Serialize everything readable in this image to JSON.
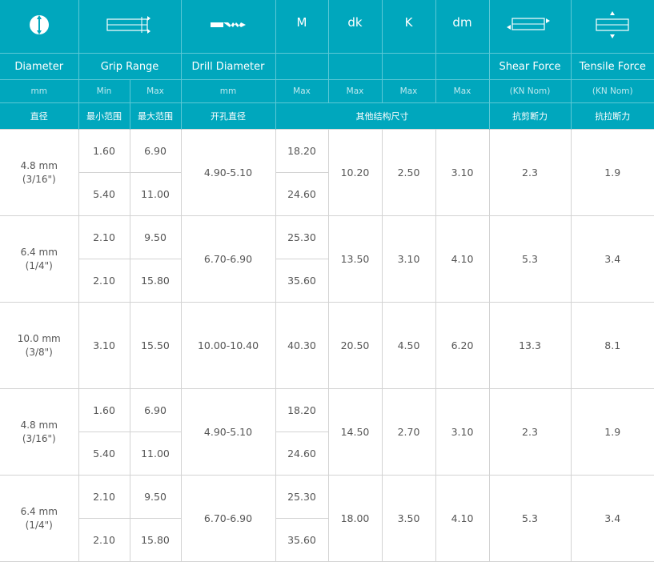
{
  "headers": {
    "diameter": {
      "title": "Diameter",
      "unit": "mm",
      "cn": "直径",
      "icon": "diameter-icon"
    },
    "grip": {
      "title": "Grip Range",
      "min": "Min",
      "max": "Max",
      "cn_min": "最小范围",
      "cn_max": "最大范围",
      "icon": "grip-range-icon"
    },
    "drill": {
      "title": "Drill Diameter",
      "unit": "mm",
      "cn": "开孔直径",
      "icon": "drill-bit-icon"
    },
    "m": {
      "symbol": "M",
      "unit": "Max"
    },
    "dk": {
      "symbol": "dk",
      "unit": "Max"
    },
    "k": {
      "symbol": "K",
      "unit": "Max"
    },
    "dm": {
      "symbol": "dm",
      "unit": "Max"
    },
    "other_cn": "其他结构尺寸",
    "shear": {
      "title": "Shear Force",
      "unit": "(KN Nom)",
      "cn": "抗剪断力",
      "icon": "shear-force-icon"
    },
    "tensile": {
      "title": "Tensile Force",
      "unit": "(KN Nom)",
      "cn": "抗拉断力",
      "icon": "tensile-force-icon"
    }
  },
  "colors": {
    "header_bg": "#00a7bd",
    "header_text": "#ffffff",
    "cell_text": "#555555",
    "border": "#d3d3d3"
  },
  "rows": [
    {
      "dia": "4.8 mm",
      "dia_in": "(3/16\")",
      "g1_min": "1.60",
      "g1_max": "6.90",
      "g2_min": "5.40",
      "g2_max": "11.00",
      "drill": "4.90-5.10",
      "m1": "18.20",
      "m2": "24.60",
      "dk": "10.20",
      "k": "2.50",
      "dm": "3.10",
      "shear": "2.3",
      "tensile": "1.9"
    },
    {
      "dia": "6.4 mm",
      "dia_in": "(1/4\")",
      "g1_min": "2.10",
      "g1_max": "9.50",
      "g2_min": "2.10",
      "g2_max": "15.80",
      "drill": "6.70-6.90",
      "m1": "25.30",
      "m2": "35.60",
      "dk": "13.50",
      "k": "3.10",
      "dm": "4.10",
      "shear": "5.3",
      "tensile": "3.4"
    },
    {
      "dia": "10.0 mm",
      "dia_in": "(3/8\")",
      "g_min": "3.10",
      "g_max": "15.50",
      "drill": "10.00-10.40",
      "m": "40.30",
      "dk": "20.50",
      "k": "4.50",
      "dm": "6.20",
      "shear": "13.3",
      "tensile": "8.1"
    },
    {
      "dia": "4.8 mm",
      "dia_in": "(3/16\")",
      "g1_min": "1.60",
      "g1_max": "6.90",
      "g2_min": "5.40",
      "g2_max": "11.00",
      "drill": "4.90-5.10",
      "m1": "18.20",
      "m2": "24.60",
      "dk": "14.50",
      "k": "2.70",
      "dm": "3.10",
      "shear": "2.3",
      "tensile": "1.9"
    },
    {
      "dia": "6.4 mm",
      "dia_in": "(1/4\")",
      "g1_min": "2.10",
      "g1_max": "9.50",
      "g2_min": "2.10",
      "g2_max": "15.80",
      "drill": "6.70-6.90",
      "m1": "25.30",
      "m2": "35.60",
      "dk": "18.00",
      "k": "3.50",
      "dm": "4.10",
      "shear": "5.3",
      "tensile": "3.4"
    }
  ]
}
